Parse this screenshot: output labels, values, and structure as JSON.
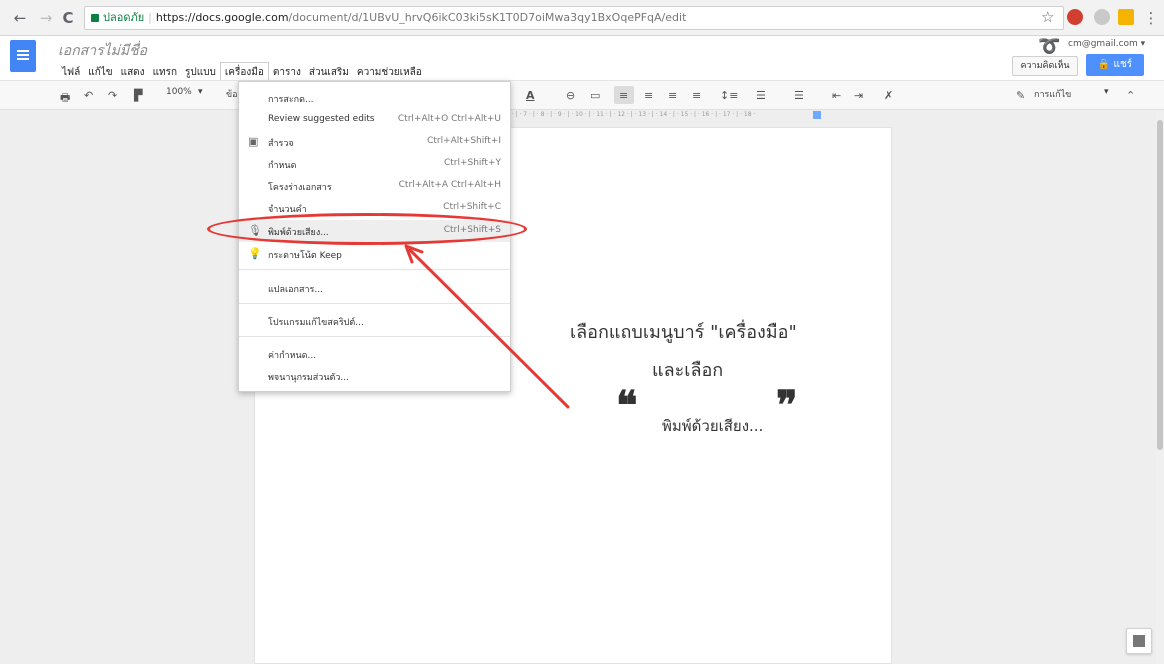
{
  "browser": {
    "back": "←",
    "forward": "→",
    "reload": "C",
    "secure_label": "ปลอดภัย",
    "url_host": "https://docs.google.com",
    "url_path": "/document/d/1UBvU_hrvQ6ikC03ki5sK1T0D7oiMwa3qy1BxOqePFqA/edit",
    "star": "☆",
    "menu": "⋮"
  },
  "docs": {
    "title": "เอกสารไม่มีชื่อ",
    "account": "cm@gmail.com ▾",
    "comments_button": "ความคิดเห็น",
    "share_button": "🔒 แชร์",
    "menus": [
      "ไฟล์",
      "แก้ไข",
      "แสดง",
      "แทรก",
      "รูปแบบ",
      "เครื่องมือ",
      "ตาราง",
      "ส่วนเสริม",
      "ความช่วยเหลือ"
    ],
    "active_menu_index": 5
  },
  "toolbar": {
    "zoom": "100%",
    "style": "ข้อ",
    "editing_mode": "การแก้ไข",
    "text_color_label": "A"
  },
  "ruler": "5 · | · 7 · | · 8 · | · 9 · | · 10 · | · 11 · | · 12 · | · 13 · | · 14 · | · 15 · | · 16 · | · 17 · | · 18 ·",
  "tools_menu": {
    "items": [
      {
        "label": "การสะกด...",
        "shortcut": "",
        "icon": ""
      },
      {
        "label": "Review suggested edits",
        "shortcut": "Ctrl+Alt+O Ctrl+Alt+U",
        "icon": ""
      },
      {
        "label": "สำรวจ",
        "shortcut": "Ctrl+Alt+Shift+I",
        "icon": "explore-icon"
      },
      {
        "label": "กำหนด",
        "shortcut": "Ctrl+Shift+Y",
        "icon": ""
      },
      {
        "label": "โครงร่างเอกสาร",
        "shortcut": "Ctrl+Alt+A Ctrl+Alt+H",
        "icon": ""
      },
      {
        "label": "จำนวนคำ",
        "shortcut": "Ctrl+Shift+C",
        "icon": ""
      },
      {
        "label": "พิมพ์ด้วยเสียง...",
        "shortcut": "Ctrl+Shift+S",
        "icon": "microphone-icon"
      },
      {
        "label": "กระดาษโน้ต Keep",
        "shortcut": "",
        "icon": "lightbulb-icon"
      },
      {
        "label": "แปลเอกสาร...",
        "shortcut": "",
        "icon": ""
      },
      {
        "label": "โปรแกรมแก้ไขสคริปต์...",
        "shortcut": "",
        "icon": ""
      },
      {
        "label": "ค่ากำหนด...",
        "shortcut": "",
        "icon": ""
      },
      {
        "label": "พจนานุกรมส่วนตัว...",
        "shortcut": "",
        "icon": ""
      }
    ]
  },
  "annotation": {
    "line1": "เลือกแถบเมนูบาร์ \"เครื่องมือ\"",
    "line2": "และเลือก",
    "open_quote": "❝",
    "close_quote": "❞",
    "quoted": "พิมพ์ด้วยเสียง...",
    "color": "#e53935"
  }
}
